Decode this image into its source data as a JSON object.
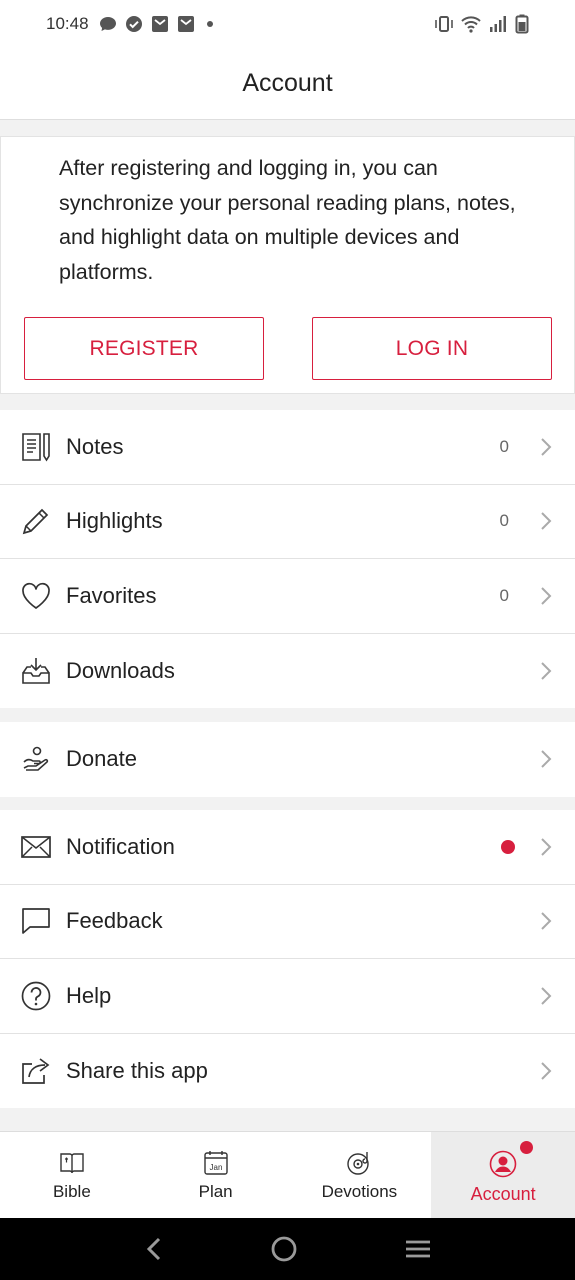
{
  "status_bar": {
    "time": "10:48"
  },
  "header": {
    "title": "Account"
  },
  "promo": {
    "text": "After registering and logging in, you can synchronize your personal reading plans, notes, and highlight data on multiple devices and platforms.",
    "register_label": "REGISTER",
    "login_label": "LOG IN"
  },
  "library": {
    "items": [
      {
        "label": "Notes",
        "count": "0",
        "icon": "notes-icon"
      },
      {
        "label": "Highlights",
        "count": "0",
        "icon": "pencil-icon"
      },
      {
        "label": "Favorites",
        "count": "0",
        "icon": "heart-icon"
      },
      {
        "label": "Downloads",
        "count": "",
        "icon": "download-tray-icon"
      }
    ]
  },
  "support": {
    "items": [
      {
        "label": "Donate",
        "icon": "donate-hand-icon"
      }
    ]
  },
  "more": {
    "items": [
      {
        "label": "Notification",
        "icon": "envelope-icon",
        "has_dot": true
      },
      {
        "label": "Feedback",
        "icon": "speech-bubble-icon"
      },
      {
        "label": "Help",
        "icon": "question-circle-icon"
      },
      {
        "label": "Share this app",
        "icon": "share-icon"
      }
    ]
  },
  "tabs": [
    {
      "label": "Bible",
      "icon": "bible-book-icon",
      "active": false
    },
    {
      "label": "Plan",
      "icon": "calendar-jan-icon",
      "active": false,
      "icon_text": "Jan"
    },
    {
      "label": "Devotions",
      "icon": "record-note-icon",
      "active": false
    },
    {
      "label": "Account",
      "icon": "person-circle-icon",
      "active": true
    }
  ],
  "colors": {
    "accent": "#d71f3e",
    "background": "#f2f2f2",
    "surface": "#ffffff"
  }
}
